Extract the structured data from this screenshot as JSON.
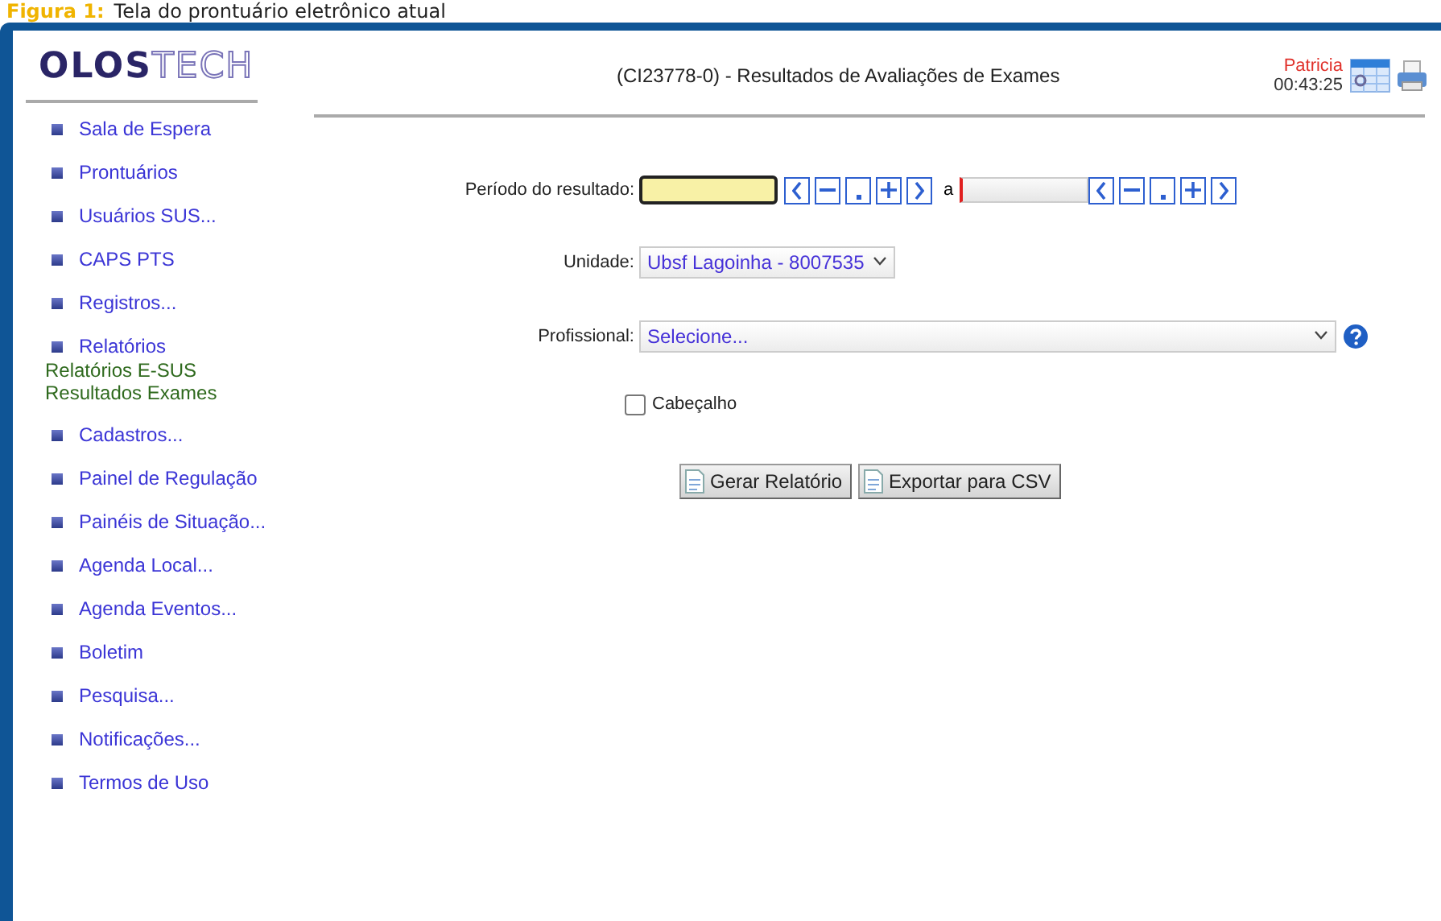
{
  "caption": {
    "label": "Figura 1:",
    "text": "Tela do prontuário eletrônico atual"
  },
  "logo": {
    "strong": "OLOS",
    "light": "TECH"
  },
  "header": {
    "title": "(CI23778-0) - Resultados de Avaliações de Exames",
    "user": "Patricia",
    "time": "00:43:25"
  },
  "sidebar": {
    "items": [
      {
        "label": "Sala de Espera"
      },
      {
        "label": "Prontuários"
      },
      {
        "label": "Usuários SUS..."
      },
      {
        "label": "CAPS PTS"
      },
      {
        "label": "Registros..."
      },
      {
        "label": "Relatórios",
        "children": [
          {
            "label": "Relatórios E-SUS"
          },
          {
            "label": "Resultados Exames"
          }
        ]
      },
      {
        "label": "Cadastros..."
      },
      {
        "label": "Painel de Regulação"
      },
      {
        "label": "Painéis de Situação..."
      },
      {
        "label": "Agenda Local..."
      },
      {
        "label": "Agenda Eventos..."
      },
      {
        "label": "Boletim"
      },
      {
        "label": "Pesquisa..."
      },
      {
        "label": "Notificações..."
      },
      {
        "label": "Termos de Uso"
      }
    ]
  },
  "form": {
    "period": {
      "label": "Período do resultado:",
      "separator": "a",
      "fields": [
        {
          "highlighted": true
        },
        {
          "highlighted": false
        }
      ]
    },
    "unit": {
      "label": "Unidade:",
      "value": "Ubsf Lagoinha - 8007535"
    },
    "professional": {
      "label": "Profissional:",
      "value": "Selecione..."
    },
    "header_option": {
      "label": "Cabeçalho",
      "checked": false
    },
    "buttons": [
      "Gerar Relatório",
      "Exportar para CSV"
    ]
  }
}
